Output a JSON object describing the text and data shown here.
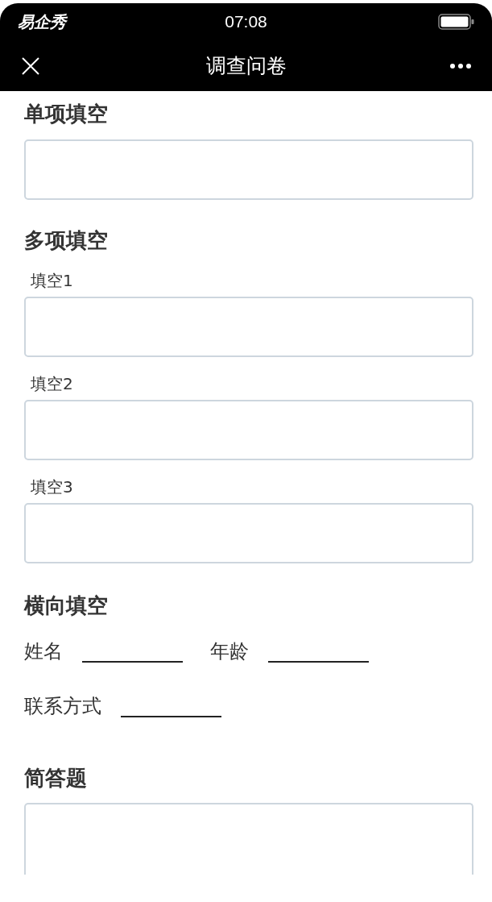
{
  "status_bar": {
    "carrier": "易企秀",
    "time": "07:08"
  },
  "nav_bar": {
    "title": "调查问卷"
  },
  "sections": [
    {
      "kind": "single",
      "title": "单项填空"
    },
    {
      "kind": "multi",
      "title": "多项填空",
      "fields": [
        {
          "label": "填空1"
        },
        {
          "label": "填空2"
        },
        {
          "label": "填空3"
        }
      ]
    },
    {
      "kind": "inline",
      "title": "横向填空",
      "rows": [
        {
          "items": [
            {
              "label": "姓名"
            },
            {
              "label": "年龄"
            }
          ]
        },
        {
          "items": [
            {
              "label": "联系方式"
            }
          ]
        }
      ]
    },
    {
      "kind": "textarea",
      "title": "简答题"
    }
  ]
}
